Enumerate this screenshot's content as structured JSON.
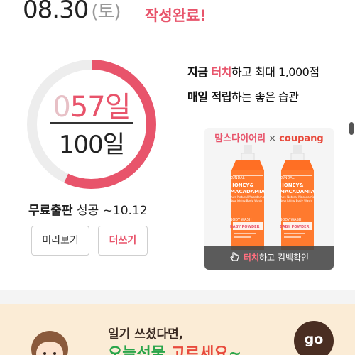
{
  "header": {
    "date": "08.30",
    "day": "(토)",
    "status": "작성완료!"
  },
  "progress": {
    "count_lead": "0",
    "count": "57",
    "unit": "일",
    "total": "100일",
    "fraction": 0.57,
    "accent": "#e8546b"
  },
  "success": {
    "bold": "무료출판",
    "rest": " 성공 ~10.12"
  },
  "buttons": {
    "preview": "미리보기",
    "write_more": "더쓰기"
  },
  "promo": {
    "line1_a": "지금 ",
    "line1_hl": "터치",
    "line1_b": "하고 최대 1,000점",
    "line2_bold": "매일 적립",
    "line2_rest": "하는 좋은 습관"
  },
  "ad": {
    "brand1": "맘스다이어리",
    "brand_x": " × ",
    "brand2": "coupang",
    "bottle_brand": "KUNDAL",
    "bottle_name1": "HONEY&",
    "bottle_name2": "MACADAMIA",
    "bottle_sub": "Pure Natural Macadamia Nourishing Body Wash",
    "bottle_type": "BODY WASH",
    "bottle_scent": "BABY POWDER",
    "cta_hl": "터치",
    "cta_rest": "하고 컴백확인"
  },
  "banner": {
    "line1": "일기 쓰셨다면,",
    "line2a": "오늘선물 ",
    "line2b": "고르세요",
    "line2c": "~",
    "go": "go"
  },
  "icons": {
    "hand": "pointer-hand-icon"
  }
}
